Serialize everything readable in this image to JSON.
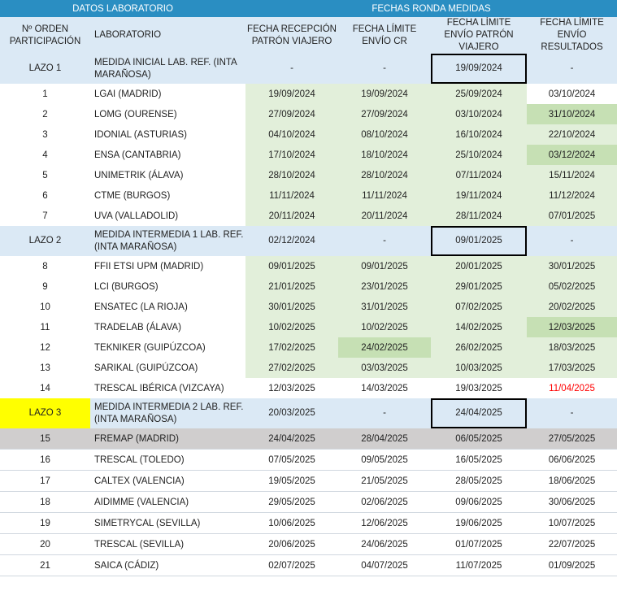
{
  "headers": {
    "group_left": "DATOS LABORATORIO",
    "group_right": "FECHAS RONDA MEDIDAS",
    "columns": [
      "Nº ORDEN PARTICIPACIÓN",
      "LABORATORIO",
      "FECHA RECEPCIÓN PATRÓN VIAJERO",
      "FECHA LÍMITE ENVÍO CR",
      "FECHA LÍMITE ENVÍO PATRÓN VIAJERO",
      "FECHA LÍMITE ENVÍO RESULTADOS"
    ]
  },
  "rows": [
    {
      "kind": "lazo",
      "order": "LAZO 1",
      "lab": "MEDIDA INICIAL LAB. REF. (INTA MARAÑOSA)",
      "recepcion": "-",
      "limite_cr": "-",
      "limite_patron": "19/09/2024",
      "limite_resultados": "-"
    },
    {
      "kind": "data",
      "order": "1",
      "lab": "LGAI (MADRID)",
      "recepcion": "19/09/2024",
      "limite_cr": "19/09/2024",
      "limite_patron": "25/09/2024",
      "limite_resultados": "03/10/2024"
    },
    {
      "kind": "data",
      "order": "2",
      "lab": "LOMG (OURENSE)",
      "recepcion": "27/09/2024",
      "limite_cr": "27/09/2024",
      "limite_patron": "03/10/2024",
      "limite_resultados": "31/10/2024"
    },
    {
      "kind": "data",
      "order": "3",
      "lab": "IDONIAL (ASTURIAS)",
      "recepcion": "04/10/2024",
      "limite_cr": "08/10/2024",
      "limite_patron": "16/10/2024",
      "limite_resultados": "22/10/2024"
    },
    {
      "kind": "data",
      "order": "4",
      "lab": "ENSA (CANTABRIA)",
      "recepcion": "17/10/2024",
      "limite_cr": "18/10/2024",
      "limite_patron": "25/10/2024",
      "limite_resultados": "03/12/2024"
    },
    {
      "kind": "data",
      "order": "5",
      "lab": "UNIMETRIK (ÁLAVA)",
      "recepcion": "28/10/2024",
      "limite_cr": "28/10/2024",
      "limite_patron": "07/11/2024",
      "limite_resultados": "15/11/2024"
    },
    {
      "kind": "data",
      "order": "6",
      "lab": "CTME (BURGOS)",
      "recepcion": "11/11/2024",
      "limite_cr": "11/11/2024",
      "limite_patron": "19/11/2024",
      "limite_resultados": "11/12/2024"
    },
    {
      "kind": "data",
      "order": "7",
      "lab": "UVA (VALLADOLID)",
      "recepcion": "20/11/2024",
      "limite_cr": "20/11/2024",
      "limite_patron": "28/11/2024",
      "limite_resultados": "07/01/2025"
    },
    {
      "kind": "lazo",
      "order": "LAZO 2",
      "lab": "MEDIDA INTERMEDIA 1 LAB. REF. (INTA MARAÑOSA)",
      "recepcion": "02/12/2024",
      "limite_cr": "-",
      "limite_patron": "09/01/2025",
      "limite_resultados": "-"
    },
    {
      "kind": "data",
      "order": "8",
      "lab": "FFII ETSI UPM (MADRID)",
      "recepcion": "09/01/2025",
      "limite_cr": "09/01/2025",
      "limite_patron": "20/01/2025",
      "limite_resultados": "30/01/2025"
    },
    {
      "kind": "data",
      "order": "9",
      "lab": "LCI (BURGOS)",
      "recepcion": "21/01/2025",
      "limite_cr": "23/01/2025",
      "limite_patron": "29/01/2025",
      "limite_resultados": "05/02/2025"
    },
    {
      "kind": "data",
      "order": "10",
      "lab": "ENSATEC (LA RIOJA)",
      "recepcion": "30/01/2025",
      "limite_cr": "31/01/2025",
      "limite_patron": "07/02/2025",
      "limite_resultados": "20/02/2025"
    },
    {
      "kind": "data",
      "order": "11",
      "lab": "TRADELAB (ÁLAVA)",
      "recepcion": "10/02/2025",
      "limite_cr": "10/02/2025",
      "limite_patron": "14/02/2025",
      "limite_resultados": "12/03/2025"
    },
    {
      "kind": "data",
      "order": "12",
      "lab": "TEKNIKER (GUIPÚZCOA)",
      "recepcion": "17/02/2025",
      "limite_cr": "24/02/2025",
      "limite_patron": "26/02/2025",
      "limite_resultados": "18/03/2025"
    },
    {
      "kind": "data",
      "order": "13",
      "lab": "SARIKAL (GUIPÚZCOA)",
      "recepcion": "27/02/2025",
      "limite_cr": "03/03/2025",
      "limite_patron": "10/03/2025",
      "limite_resultados": "17/03/2025"
    },
    {
      "kind": "data",
      "order": "14",
      "lab": "TRESCAL IBÉRICA (VIZCAYA)",
      "recepcion": "12/03/2025",
      "limite_cr": "14/03/2025",
      "limite_patron": "19/03/2025",
      "limite_resultados": "11/04/2025"
    },
    {
      "kind": "lazo",
      "order": "LAZO 3",
      "lab": "MEDIDA INTERMEDIA 2 LAB. REF. (INTA MARAÑOSA)",
      "recepcion": "20/03/2025",
      "limite_cr": "-",
      "limite_patron": "24/04/2025",
      "limite_resultados": "-"
    },
    {
      "kind": "data",
      "order": "15",
      "lab": "FREMAP (MADRID)",
      "recepcion": "24/04/2025",
      "limite_cr": "28/04/2025",
      "limite_patron": "06/05/2025",
      "limite_resultados": "27/05/2025"
    },
    {
      "kind": "data",
      "order": "16",
      "lab": "TRESCAL (TOLEDO)",
      "recepcion": "07/05/2025",
      "limite_cr": "09/05/2025",
      "limite_patron": "16/05/2025",
      "limite_resultados": "06/06/2025"
    },
    {
      "kind": "data",
      "order": "17",
      "lab": "CALTEX (VALENCIA)",
      "recepcion": "19/05/2025",
      "limite_cr": "21/05/2025",
      "limite_patron": "28/05/2025",
      "limite_resultados": "18/06/2025"
    },
    {
      "kind": "data",
      "order": "18",
      "lab": "AIDIMME (VALENCIA)",
      "recepcion": "29/05/2025",
      "limite_cr": "02/06/2025",
      "limite_patron": "09/06/2025",
      "limite_resultados": "30/06/2025"
    },
    {
      "kind": "data",
      "order": "19",
      "lab": "SIMETRYCAL (SEVILLA)",
      "recepcion": "10/06/2025",
      "limite_cr": "12/06/2025",
      "limite_patron": "19/06/2025",
      "limite_resultados": "10/07/2025"
    },
    {
      "kind": "data",
      "order": "20",
      "lab": "TRESCAL (SEVILLA)",
      "recepcion": "20/06/2025",
      "limite_cr": "24/06/2025",
      "limite_patron": "01/07/2025",
      "limite_resultados": "22/07/2025"
    },
    {
      "kind": "data",
      "order": "21",
      "lab": "SAICA (CÁDIZ)",
      "recepcion": "02/07/2025",
      "limite_cr": "04/07/2025",
      "limite_patron": "11/07/2025",
      "limite_resultados": "01/09/2025"
    }
  ],
  "colors": {
    "header_blue": "#2a8ec2",
    "light_blue": "#dbe9f5",
    "light_green": "#e2efda",
    "dark_green": "#c6e0b4",
    "highlight_yellow": "#ffff00",
    "gray_row": "#d0cece",
    "late_red": "#ff0000"
  }
}
